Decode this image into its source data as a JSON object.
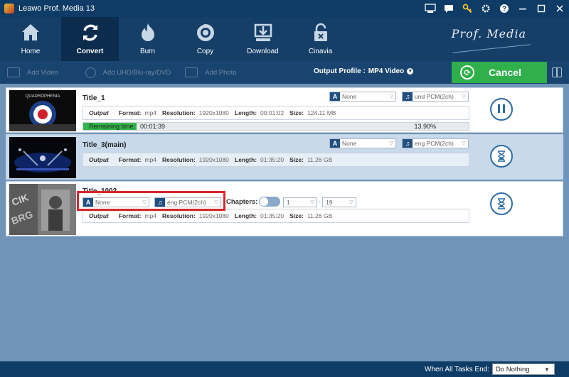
{
  "window": {
    "title": "Leawo Prof. Media 13"
  },
  "toolbar": {
    "items": [
      {
        "label": "Home",
        "icon": "home-icon"
      },
      {
        "label": "Convert",
        "icon": "convert-icon",
        "active": true
      },
      {
        "label": "Burn",
        "icon": "burn-icon"
      },
      {
        "label": "Copy",
        "icon": "copy-icon"
      },
      {
        "label": "Download",
        "icon": "download-icon"
      },
      {
        "label": "Cinavia",
        "icon": "cinavia-icon"
      }
    ],
    "brand": "Prof. Media"
  },
  "subbar": {
    "add_video": "Add Video",
    "add_disc": "Add UHD/Blu-ray/DVD",
    "add_photo": "Add Photo",
    "output_profile_label": "Output Profile :",
    "output_profile_value": "MP4 Video",
    "cancel_label": "Cancel"
  },
  "tasks": [
    {
      "title": "Title_1",
      "subtitle": "None",
      "audio": "und PCM(2ch)",
      "output_label": "Output",
      "format_label": "Format:",
      "format": "mp4",
      "resolution_label": "Resolution:",
      "resolution": "1920x1080",
      "length_label": "Length:",
      "length": "00:01:02",
      "size_label": "Size:",
      "size": "124.11 MB",
      "progress": {
        "label": "Remaining time:",
        "time": "00:01:39",
        "percent_text": "13.90%",
        "percent": 13.9
      }
    },
    {
      "title": "Title_3(main)",
      "subtitle": "None",
      "audio": "eng PCM(2ch)",
      "output_label": "Output",
      "format_label": "Format:",
      "format": "mp4",
      "resolution_label": "Resolution:",
      "resolution": "1920x1080",
      "length_label": "Length:",
      "length": "01:35:20",
      "size_label": "Size:",
      "size": "11.26 GB"
    },
    {
      "title": "Title_1002",
      "subtitle": "None",
      "audio": "eng PCM(2ch)",
      "chapters_label": "Chapters:",
      "chapter_from": "1",
      "chapter_sep": "-",
      "chapter_to": "19",
      "output_label": "Output",
      "format_label": "Format:",
      "format": "mp4",
      "resolution_label": "Resolution:",
      "resolution": "1920x1080",
      "length_label": "Length:",
      "length": "01:35:20",
      "size_label": "Size:",
      "size": "11.26 GB"
    }
  ],
  "thumbs": {
    "t1_text": "QUADROPHENIA"
  },
  "footer": {
    "label": "When All Tasks End:",
    "value": "Do Nothing"
  },
  "colors": {
    "accent_green": "#2fb04a",
    "highlight_red": "#d9262c",
    "header": "#163f68"
  }
}
